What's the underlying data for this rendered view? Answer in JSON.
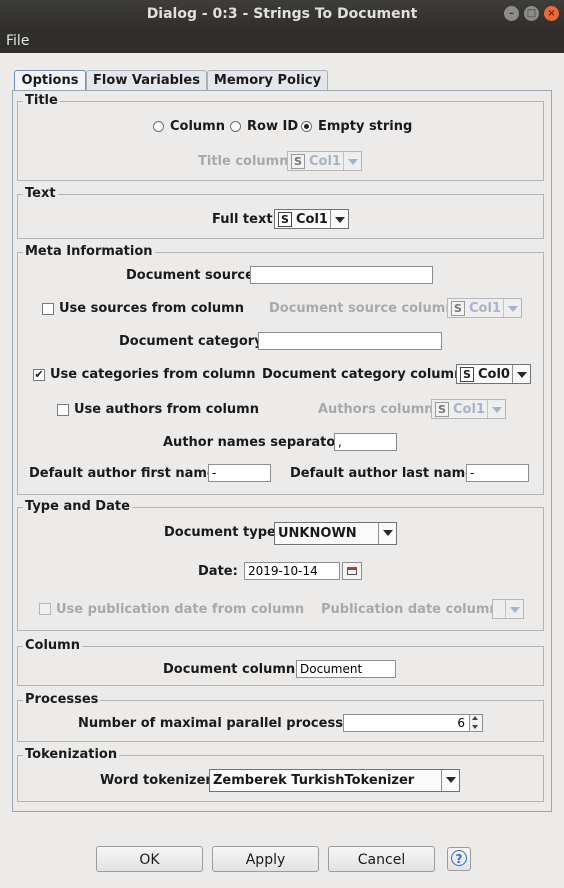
{
  "window": {
    "title": "Dialog - 0:3 - Strings To Document"
  },
  "menu": {
    "file": "File"
  },
  "tabs": [
    "Options",
    "Flow Variables",
    "Memory Policy"
  ],
  "title_group": {
    "label": "Title",
    "radio_column": "Column",
    "radio_rowid": "Row ID",
    "radio_empty": "Empty string",
    "selected": "Empty string",
    "title_column_label": "Title column",
    "title_column_value": "Col1"
  },
  "text_group": {
    "label": "Text",
    "full_text_label": "Full text",
    "full_text_value": "Col1"
  },
  "meta": {
    "label": "Meta Information",
    "doc_source_label": "Document source",
    "doc_source_value": "",
    "use_sources_label": "Use sources from column",
    "use_sources_checked": false,
    "doc_source_column_label": "Document source column",
    "doc_source_column_value": "Col1",
    "doc_category_label": "Document category",
    "doc_category_value": "",
    "use_categories_label": "Use categories from column",
    "use_categories_checked": true,
    "doc_category_column_label": "Document category column",
    "doc_category_column_value": "Col0",
    "use_authors_label": "Use authors from column",
    "use_authors_checked": false,
    "authors_column_label": "Authors column",
    "authors_column_value": "Col1",
    "author_sep_label": "Author names separator",
    "author_sep_value": ",",
    "first_name_label": "Default author first name",
    "first_name_value": "-",
    "last_name_label": "Default author last name",
    "last_name_value": "-"
  },
  "type_date": {
    "label": "Type and Date",
    "doc_type_label": "Document type",
    "doc_type_value": "UNKNOWN",
    "date_label": "Date:",
    "date_value": "2019-10-14",
    "use_pub_date_label": "Use publication date from column",
    "pub_date_column_label": "Publication date column"
  },
  "column_group": {
    "label": "Column",
    "doc_column_label": "Document column:",
    "doc_column_value": "Document"
  },
  "processes": {
    "label": "Processes",
    "max_label": "Number of maximal parallel processes",
    "max_value": "6"
  },
  "tokenization": {
    "label": "Tokenization",
    "word_tokenizer_label": "Word tokenizer",
    "word_tokenizer_value": "Zemberek TurkishTokenizer"
  },
  "buttons": {
    "ok": "OK",
    "apply": "Apply",
    "cancel": "Cancel"
  },
  "icons": [
    "minimize-icon",
    "maximize-icon",
    "close-icon",
    "calendar-icon",
    "spinner-up-icon",
    "spinner-down-icon",
    "help-icon"
  ]
}
